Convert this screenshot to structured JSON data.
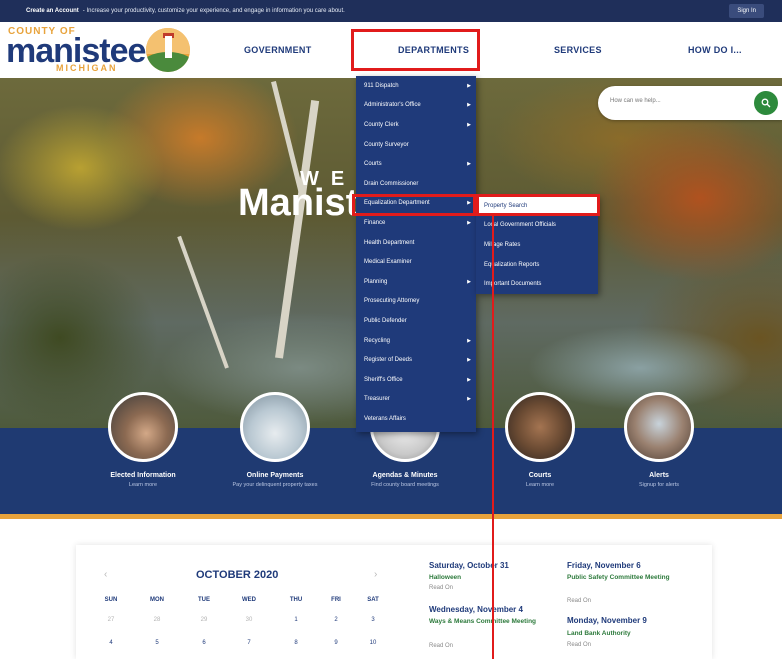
{
  "topbar": {
    "create_label": "Create an Account",
    "create_text": "- Increase your productivity, customize your experience, and engage in information you care about.",
    "signin": "Sign In"
  },
  "logo": {
    "county": "COUNTY OF",
    "name": "manistee",
    "state": "MICHIGAN"
  },
  "nav": [
    "GOVERNMENT",
    "DEPARTMENTS",
    "SERVICES",
    "HOW DO I..."
  ],
  "search": {
    "placeholder": "How can we help..."
  },
  "hero": {
    "welcome": "WEL        O",
    "title": "Manist"
  },
  "departments_menu": [
    {
      "label": "911 Dispatch",
      "has_sub": true
    },
    {
      "label": "Administrator's Office",
      "has_sub": true
    },
    {
      "label": "County Clerk",
      "has_sub": true
    },
    {
      "label": "County Surveyor",
      "has_sub": false
    },
    {
      "label": "Courts",
      "has_sub": true
    },
    {
      "label": "Drain Commissioner",
      "has_sub": false
    },
    {
      "label": "Equalization Department",
      "has_sub": true
    },
    {
      "label": "Finance",
      "has_sub": true
    },
    {
      "label": "Health Department",
      "has_sub": false
    },
    {
      "label": "Medical Examiner",
      "has_sub": false
    },
    {
      "label": "Planning",
      "has_sub": true
    },
    {
      "label": "Prosecuting Attorney",
      "has_sub": false
    },
    {
      "label": "Public Defender",
      "has_sub": false
    },
    {
      "label": "Recycling",
      "has_sub": true
    },
    {
      "label": "Register of Deeds",
      "has_sub": true
    },
    {
      "label": "Sheriff's Office",
      "has_sub": true
    },
    {
      "label": "Treasurer",
      "has_sub": true
    },
    {
      "label": "Veterans Affairs",
      "has_sub": false
    }
  ],
  "equalization_submenu": [
    "Property Search",
    "Local Government Officials",
    "Millage Rates",
    "Equalization Reports",
    "Important Documents"
  ],
  "quick_links": [
    {
      "title": "Elected Information",
      "subtitle": "Learn more",
      "icon": "hand-icon"
    },
    {
      "title": "Online Payments",
      "subtitle": "Pay your delinquent property taxes",
      "icon": "laptop-icon"
    },
    {
      "title": "Agendas & Minutes",
      "subtitle": "Find county board meetings",
      "icon": "document-icon"
    },
    {
      "title": "Courts",
      "subtitle": "Learn more",
      "icon": "gavel-icon"
    },
    {
      "title": "Alerts",
      "subtitle": "Signup for alerts",
      "icon": "phone-icon"
    }
  ],
  "calendar": {
    "month": "OCTOBER 2020",
    "days": [
      "SUN",
      "MON",
      "TUE",
      "WED",
      "THU",
      "FRI",
      "SAT"
    ],
    "week1": [
      "27",
      "28",
      "29",
      "30",
      "1",
      "2",
      "3"
    ],
    "week2": [
      "4",
      "5",
      "6",
      "7",
      "8",
      "9",
      "10"
    ]
  },
  "events": [
    {
      "date": "Saturday, October 31",
      "title": "Halloween",
      "read": "Read On"
    },
    {
      "date": "Friday, November 6",
      "title": "Public Safety Committee Meeting",
      "read": "Read On"
    },
    {
      "date": "Wednesday, November 4",
      "title": "Ways & Means Committee Meeting",
      "read": "Read On"
    },
    {
      "date": "Monday, November 9",
      "title": "Land Bank Authority",
      "read": "Read On"
    }
  ],
  "colors": {
    "navy": "#1f3a7a",
    "orange": "#e8a33c",
    "green": "#2d8a3c",
    "highlight_red": "#e11b1b"
  }
}
